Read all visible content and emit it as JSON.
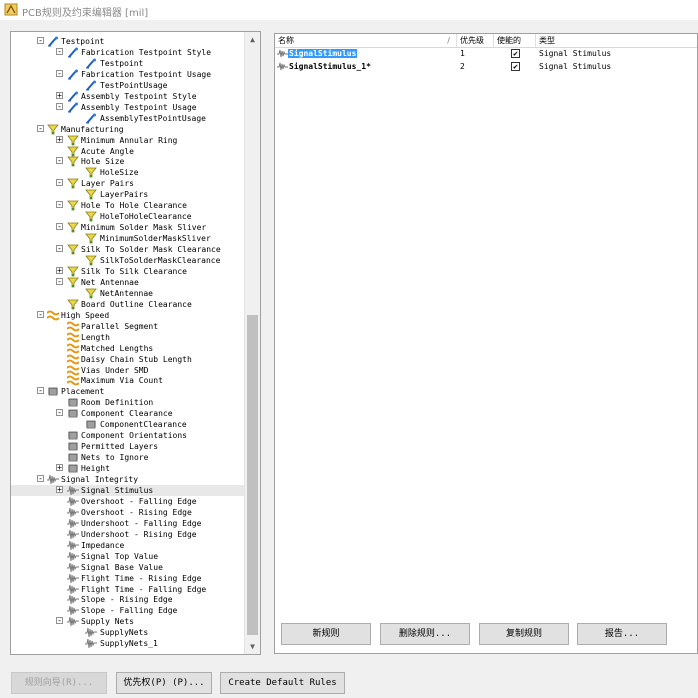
{
  "window": {
    "title": "PCB规则及约束编辑器 [mil]"
  },
  "tree": {
    "items": [
      {
        "label": "Testpoint",
        "level": 0,
        "exp": "-",
        "icon": "testpoint-icon"
      },
      {
        "label": "Fabrication Testpoint Style",
        "level": 1,
        "exp": "-",
        "icon": "testpoint-icon"
      },
      {
        "label": "Testpoint",
        "level": 2,
        "exp": "",
        "icon": "testpoint-icon"
      },
      {
        "label": "Fabrication Testpoint Usage",
        "level": 1,
        "exp": "-",
        "icon": "testpoint-icon"
      },
      {
        "label": "TestPointUsage",
        "level": 2,
        "exp": "",
        "icon": "testpoint-icon"
      },
      {
        "label": "Assembly Testpoint Style",
        "level": 1,
        "exp": "+",
        "icon": "testpoint-icon"
      },
      {
        "label": "Assembly Testpoint Usage",
        "level": 1,
        "exp": "-",
        "icon": "testpoint-icon"
      },
      {
        "label": "AssemblyTestPointUsage",
        "level": 2,
        "exp": "",
        "icon": "testpoint-icon"
      },
      {
        "label": "Manufacturing",
        "level": 0,
        "exp": "-",
        "icon": "manufacturing-icon"
      },
      {
        "label": "Minimum Annular Ring",
        "level": 1,
        "exp": "+",
        "icon": "manufacturing-icon"
      },
      {
        "label": "Acute Angle",
        "level": 1,
        "exp": "",
        "icon": "manufacturing-icon"
      },
      {
        "label": "Hole Size",
        "level": 1,
        "exp": "-",
        "icon": "manufacturing-icon"
      },
      {
        "label": "HoleSize",
        "level": 2,
        "exp": "",
        "icon": "manufacturing-icon"
      },
      {
        "label": "Layer Pairs",
        "level": 1,
        "exp": "-",
        "icon": "manufacturing-icon"
      },
      {
        "label": "LayerPairs",
        "level": 2,
        "exp": "",
        "icon": "manufacturing-icon"
      },
      {
        "label": "Hole To Hole Clearance",
        "level": 1,
        "exp": "-",
        "icon": "manufacturing-icon"
      },
      {
        "label": "HoleToHoleClearance",
        "level": 2,
        "exp": "",
        "icon": "manufacturing-icon"
      },
      {
        "label": "Minimum Solder Mask Sliver",
        "level": 1,
        "exp": "-",
        "icon": "manufacturing-icon"
      },
      {
        "label": "MinimumSolderMaskSliver",
        "level": 2,
        "exp": "",
        "icon": "manufacturing-icon"
      },
      {
        "label": "Silk To Solder Mask Clearance",
        "level": 1,
        "exp": "-",
        "icon": "manufacturing-icon"
      },
      {
        "label": "SilkToSolderMaskClearance",
        "level": 2,
        "exp": "",
        "icon": "manufacturing-icon"
      },
      {
        "label": "Silk To Silk Clearance",
        "level": 1,
        "exp": "+",
        "icon": "manufacturing-icon"
      },
      {
        "label": "Net Antennae",
        "level": 1,
        "exp": "-",
        "icon": "manufacturing-icon"
      },
      {
        "label": "NetAntennae",
        "level": 2,
        "exp": "",
        "icon": "manufacturing-icon"
      },
      {
        "label": "Board Outline Clearance",
        "level": 1,
        "exp": "",
        "icon": "manufacturing-icon"
      },
      {
        "label": "High Speed",
        "level": 0,
        "exp": "-",
        "icon": "highspeed-icon"
      },
      {
        "label": "Parallel Segment",
        "level": 1,
        "exp": "",
        "icon": "highspeed-icon"
      },
      {
        "label": "Length",
        "level": 1,
        "exp": "",
        "icon": "highspeed-icon"
      },
      {
        "label": "Matched Lengths",
        "level": 1,
        "exp": "",
        "icon": "highspeed-icon"
      },
      {
        "label": "Daisy Chain Stub Length",
        "level": 1,
        "exp": "",
        "icon": "highspeed-icon"
      },
      {
        "label": "Vias Under SMD",
        "level": 1,
        "exp": "",
        "icon": "highspeed-icon"
      },
      {
        "label": "Maximum Via Count",
        "level": 1,
        "exp": "",
        "icon": "highspeed-icon"
      },
      {
        "label": "Placement",
        "level": 0,
        "exp": "-",
        "icon": "placement-icon"
      },
      {
        "label": "Room Definition",
        "level": 1,
        "exp": "",
        "icon": "placement-icon"
      },
      {
        "label": "Component Clearance",
        "level": 1,
        "exp": "-",
        "icon": "placement-icon"
      },
      {
        "label": "ComponentClearance",
        "level": 2,
        "exp": "",
        "icon": "placement-icon"
      },
      {
        "label": "Component Orientations",
        "level": 1,
        "exp": "",
        "icon": "placement-icon"
      },
      {
        "label": "Permitted Layers",
        "level": 1,
        "exp": "",
        "icon": "placement-icon"
      },
      {
        "label": "Nets to Ignore",
        "level": 1,
        "exp": "",
        "icon": "placement-icon"
      },
      {
        "label": "Height",
        "level": 1,
        "exp": "+",
        "icon": "placement-icon"
      },
      {
        "label": "Signal Integrity",
        "level": 0,
        "exp": "-",
        "icon": "signal-icon"
      },
      {
        "label": "Signal Stimulus",
        "level": 1,
        "exp": "+",
        "icon": "signal-icon",
        "selected": true
      },
      {
        "label": "Overshoot - Falling Edge",
        "level": 1,
        "exp": "",
        "icon": "signal-icon"
      },
      {
        "label": "Overshoot - Rising Edge",
        "level": 1,
        "exp": "",
        "icon": "signal-icon"
      },
      {
        "label": "Undershoot - Falling Edge",
        "level": 1,
        "exp": "",
        "icon": "signal-icon"
      },
      {
        "label": "Undershoot - Rising Edge",
        "level": 1,
        "exp": "",
        "icon": "signal-icon"
      },
      {
        "label": "Impedance",
        "level": 1,
        "exp": "",
        "icon": "signal-icon"
      },
      {
        "label": "Signal Top Value",
        "level": 1,
        "exp": "",
        "icon": "signal-icon"
      },
      {
        "label": "Signal Base Value",
        "level": 1,
        "exp": "",
        "icon": "signal-icon"
      },
      {
        "label": "Flight Time - Rising Edge",
        "level": 1,
        "exp": "",
        "icon": "signal-icon"
      },
      {
        "label": "Flight Time - Falling Edge",
        "level": 1,
        "exp": "",
        "icon": "signal-icon"
      },
      {
        "label": "Slope - Rising Edge",
        "level": 1,
        "exp": "",
        "icon": "signal-icon"
      },
      {
        "label": "Slope - Falling Edge",
        "level": 1,
        "exp": "",
        "icon": "signal-icon"
      },
      {
        "label": "Supply Nets",
        "level": 1,
        "exp": "-",
        "icon": "signal-icon"
      },
      {
        "label": "SupplyNets",
        "level": 2,
        "exp": "",
        "icon": "signal-icon"
      },
      {
        "label": "SupplyNets_1",
        "level": 2,
        "exp": "",
        "icon": "signal-icon"
      }
    ]
  },
  "grid": {
    "headers": {
      "name": "名称",
      "sort": "/",
      "priority": "优先级",
      "enabled": "使能的",
      "type": "类型"
    },
    "rows": [
      {
        "name": "SignalStimulus",
        "priority": "1",
        "enabled": "✔",
        "type": "Signal Stimulus",
        "selected": true
      },
      {
        "name": "SignalStimulus_1*",
        "priority": "2",
        "enabled": "✔",
        "type": "Signal Stimulus",
        "selected": false
      }
    ]
  },
  "buttons": {
    "new_rule": "新规则",
    "delete_rule": "删除规则...",
    "copy_rule": "复制规则",
    "report": "报告...",
    "rule_wizard": "规则向导(R)...",
    "priority": "优先权(P) (P)...",
    "create_default": "Create Default Rules"
  },
  "colors": {
    "selection": "#3399ff",
    "tree_line": "#a0a0a0"
  }
}
